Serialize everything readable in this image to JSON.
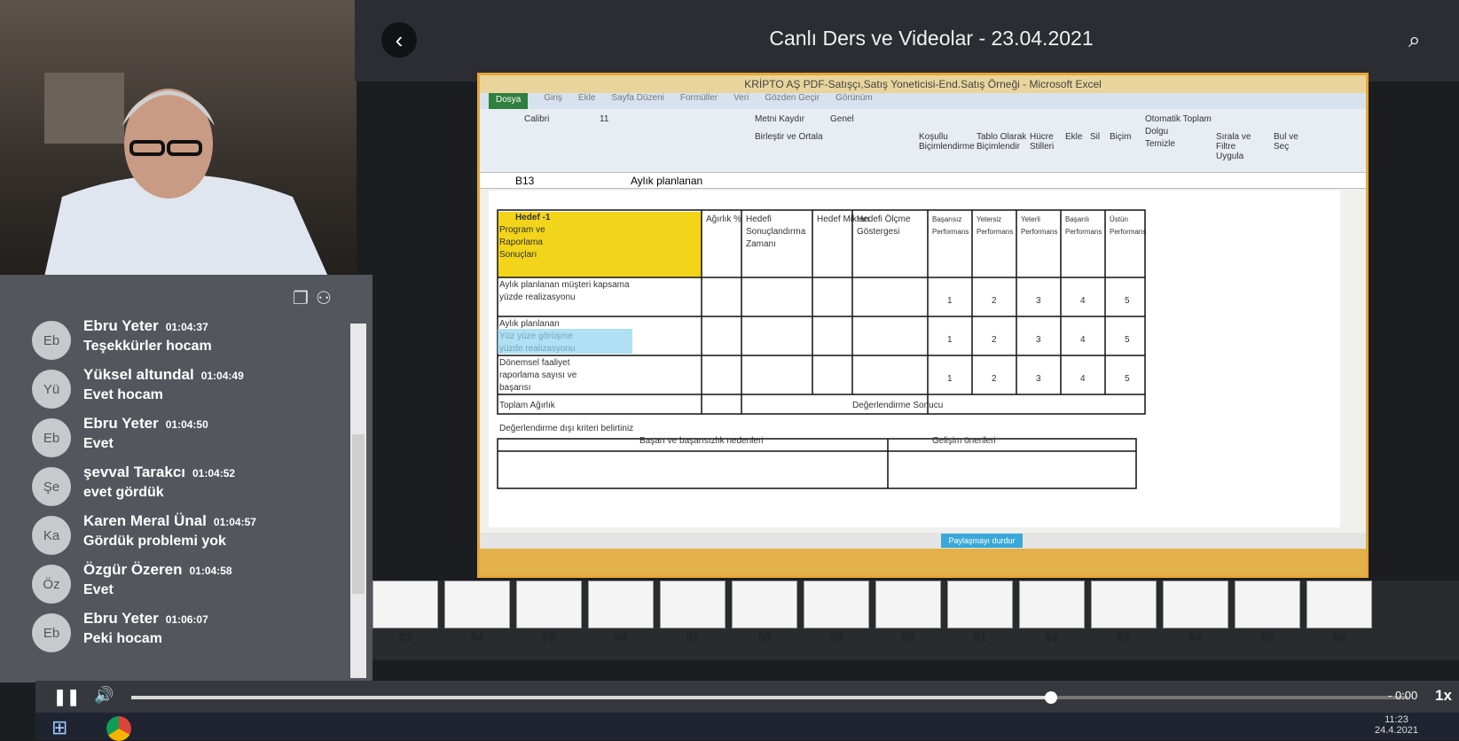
{
  "header": {
    "title": "Canlı Ders ve Videolar - 23.04.2021"
  },
  "chat": [
    {
      "initials": "Eb",
      "name": "Ebru Yeter",
      "time": "01:04:37",
      "text": "Teşekkürler hocam"
    },
    {
      "initials": "Yü",
      "name": "Yüksel altundal",
      "time": "01:04:49",
      "text": "Evet hocam"
    },
    {
      "initials": "Eb",
      "name": "Ebru Yeter",
      "time": "01:04:50",
      "text": "Evet"
    },
    {
      "initials": "Şe",
      "name": "şevval Tarakcı",
      "time": "01:04:52",
      "text": "evet gördük"
    },
    {
      "initials": "Ka",
      "name": "Karen Meral Ünal",
      "time": "01:04:57",
      "text": "Gördük problemi yok"
    },
    {
      "initials": "Öz",
      "name": "Özgür Özeren",
      "time": "01:04:58",
      "text": "Evet"
    },
    {
      "initials": "Eb",
      "name": "Ebru Yeter",
      "time": "01:06:07",
      "text": "Peki hocam"
    }
  ],
  "excel": {
    "window_title": "KRİPTO AŞ PDF-Satışçı,Satış Yoneticisi-End.Satış Örneği - Microsoft Excel",
    "tabs": [
      "Dosya",
      "Giriş",
      "Ekle",
      "Sayfa Düzeni",
      "Formüller",
      "Veri",
      "Gözden Geçir",
      "Görünüm"
    ],
    "ribbon": {
      "font": "Calibri",
      "size": "11",
      "wrap": "Metni Kaydır",
      "merge": "Birleştir ve Ortala",
      "format": "Genel",
      "cond": "Koşullu Biçimlendirme",
      "table": "Tablo Olarak Biçimlendir",
      "styles": "Hücre Stilleri",
      "insert": "Ekle",
      "delete": "Sil",
      "formatbtn": "Biçim",
      "autosum": "Otomatik Toplam",
      "fill": "Dolgu",
      "clear": "Temizle",
      "sort": "Sırala ve Filtre Uygula",
      "find": "Bul ve Seç"
    },
    "cell_ref": "B13",
    "formula": "Aylık planlanan",
    "headers": [
      "Hedef -1",
      "Program ve",
      "Raporlama",
      "Sonuçları"
    ],
    "col_heads": [
      "Ağırlık %",
      "Hedefi Sonuçlandırma Zamanı",
      "Hedef Miktarı",
      "Hedefi Ölçme Göstergesi",
      "Başarısız Performans",
      "Yetersiz Performans",
      "Yeterli Performans",
      "Başarılı Performans",
      "Üstün Performans"
    ],
    "rows": [
      "Aylık planlanan müşteri kapsama",
      "yüzde realizasyonu",
      "Aylık planlanan",
      "Yüz yüze görüşme",
      "yüzde realizasyonu",
      "Dönemsel faaliyet",
      "raporlama sayısı ve",
      "başarısı"
    ],
    "scores": [
      "1",
      "2",
      "3",
      "4",
      "5"
    ],
    "total": "Toplam Ağırlık",
    "result": "Değerlendirme Sonucu",
    "criteria": "Değerlendirme dışı kriteri belirtiniz",
    "reasons": "Başarı ve başarısızlık nedenleri",
    "suggestions": "Gelişim önerileri",
    "share": "Paylaşmayı durdur"
  },
  "thumbnails": [
    "53",
    "54",
    "55",
    "56",
    "57",
    "58",
    "59",
    "60",
    "61",
    "62",
    "63",
    "64",
    "65",
    "66"
  ],
  "player": {
    "time": "- 0:00",
    "speed": "1x",
    "progress": 0.72
  },
  "clock": {
    "time": "11:23",
    "date": "24.4.2021"
  }
}
